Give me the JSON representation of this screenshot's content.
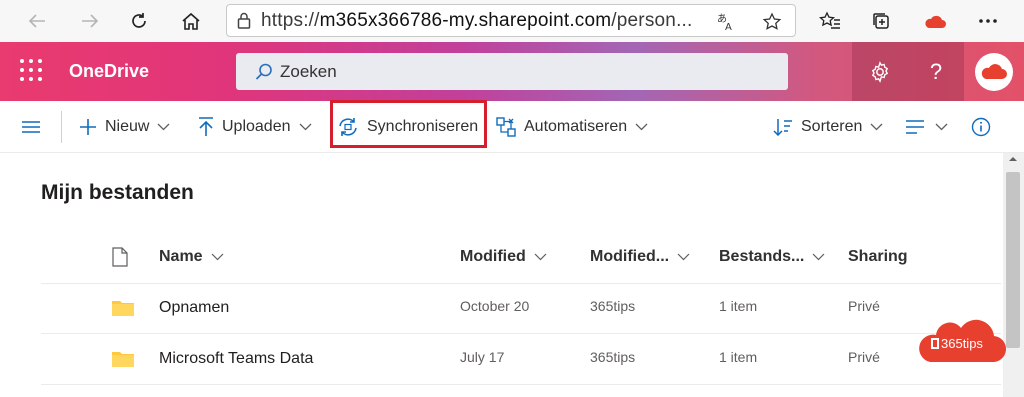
{
  "browser": {
    "url_prefix": "https://",
    "url_host": "m365x366786-my.sharepoint.com",
    "url_path": "/person..."
  },
  "suite": {
    "brand": "OneDrive",
    "search_placeholder": "Zoeken",
    "help_label": "?",
    "accent": "#e93b6f"
  },
  "commands": {
    "new": "Nieuw",
    "upload": "Uploaden",
    "sync": "Synchroniseren",
    "automate": "Automatiseren",
    "sort": "Sorteren",
    "highlight_color": "#d61f2c"
  },
  "page": {
    "title": "Mijn bestanden"
  },
  "columns": {
    "name": "Name",
    "modified": "Modified",
    "modified_by": "Modified...",
    "size": "Bestands...",
    "sharing": "Sharing"
  },
  "rows": [
    {
      "name": "Opnamen",
      "modified": "October 20",
      "modified_by": "365tips",
      "size": "1 item",
      "sharing": "Privé"
    },
    {
      "name": "Microsoft Teams Data",
      "modified": "July 17",
      "modified_by": "365tips",
      "size": "1 item",
      "sharing": "Privé"
    }
  ],
  "watermark": {
    "text": "365tips"
  }
}
